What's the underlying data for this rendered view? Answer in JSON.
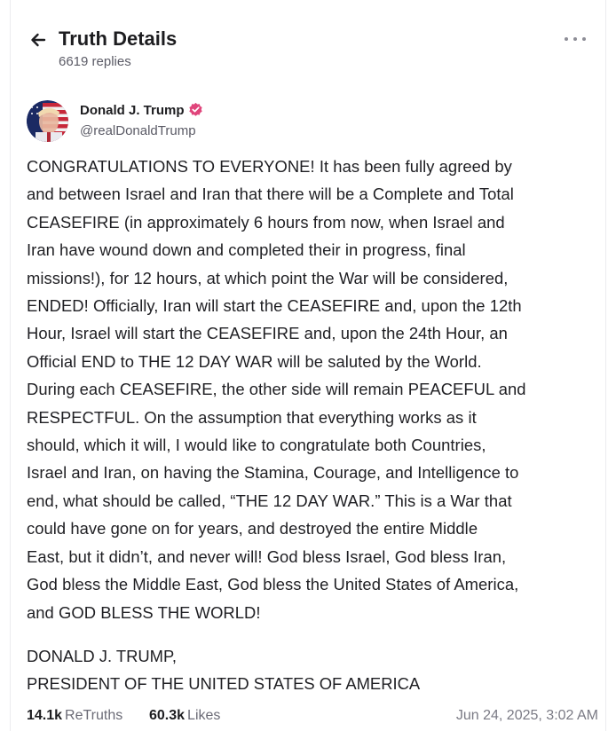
{
  "header": {
    "title": "Truth Details",
    "replies": "6619 replies",
    "back_icon": "arrow-left-icon",
    "more_icon": "more-horizontal-icon"
  },
  "author": {
    "name": "Donald J. Trump",
    "handle": "@realDonaldTrump",
    "verified_icon": "verified-badge-icon",
    "badge_color": "#e0457b"
  },
  "post": {
    "body": "CONGRATULATIONS TO EVERYONE! It has been fully agreed by\nand between Israel and Iran that there will be a Complete and Total\nCEASEFIRE (in approximately 6 hours from now, when Israel and\nIran have wound down and completed their in progress, final\nmissions!), for 12 hours, at which point the War will be considered,\nENDED! Officially, Iran will start the CEASEFIRE and, upon the 12th\nHour, Israel will start the CEASEFIRE and, upon the 24th Hour, an\nOfficial END to THE 12 DAY WAR will be saluted by the World.\nDuring each CEASEFIRE, the other side will remain PEACEFUL and\nRESPECTFUL. On the assumption that everything works as it\nshould, which it will, I would like to congratulate both Countries,\nIsrael and Iran, on having the Stamina, Courage, and Intelligence to\nend, what should be called, “THE 12 DAY WAR.” This is a War that\ncould have gone on for years, and destroyed the entire Middle\nEast, but it didn’t, and never will! God bless Israel, God bless Iran,\nGod bless the Middle East, God bless the United States of America,\nand GOD BLESS THE WORLD!",
    "signature_name": "DONALD J. TRUMP,",
    "signature_title": "PRESIDENT OF THE UNITED STATES OF AMERICA"
  },
  "stats": {
    "retruths_count": "14.1k",
    "retruths_label": "ReTruths",
    "likes_count": "60.3k",
    "likes_label": "Likes",
    "timestamp": "Jun 24, 2025, 3:02 AM"
  }
}
